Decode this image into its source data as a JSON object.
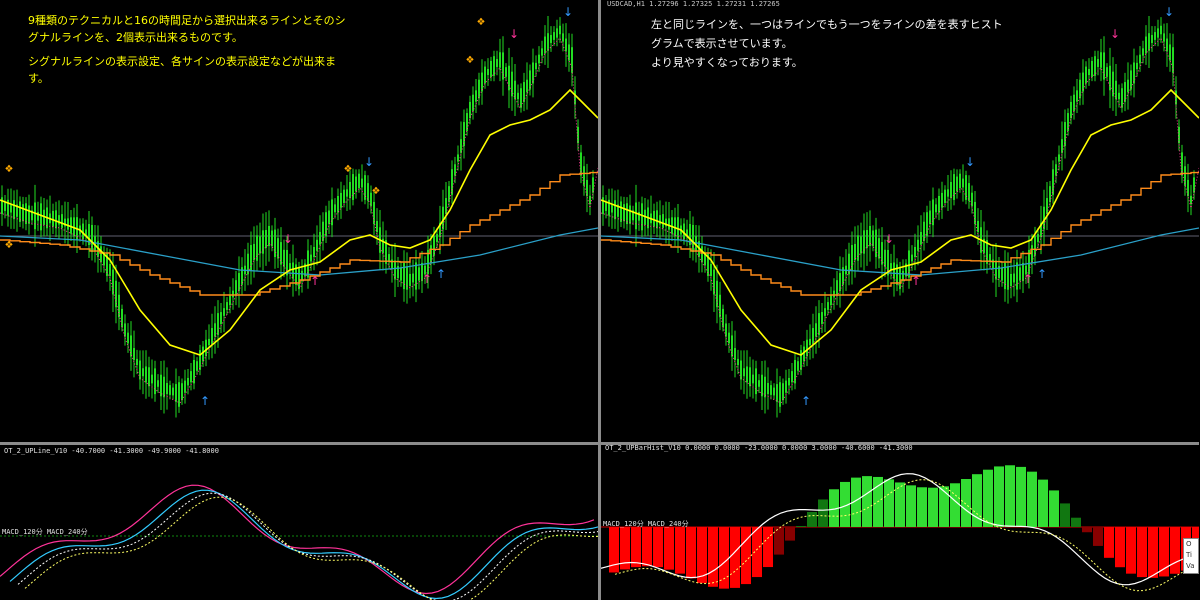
{
  "left": {
    "description_lines": [
      "9種類のテクニカルと16の時間足から選択出来るラインとそのシ",
      "グナルラインを、2個表示出来るものです。",
      "シグナルラインの表示設定、各サインの表示設定などが出来ま",
      "す。"
    ],
    "indicator_label": "OT_2_UPLine_V10 -40.7000 -41.3000 -49.9000 -41.8000",
    "macd_label": "MACD_120分  MACD_240分"
  },
  "right": {
    "symbol_label": "USDCAD,H1  1.27296 1.27325 1.27231 1.27265",
    "description_lines": [
      "左と同じラインを、一つはラインでもう一つをラインの差を表すヒスト",
      "グラムで表示させています。",
      "より見やすくなっております。"
    ],
    "indicator_label": "OT_2_UPBarHist_V10 0.0000 0.0000 -23.0000 0.0000 3.0000 -40.6000 -41.3000",
    "macd_label": "MACD_120分  MACD_240分",
    "popup_lines": [
      "O",
      "Ti",
      "Va"
    ]
  },
  "colors": {
    "background": "#000000",
    "candle": "#22dd22",
    "yellow_ma": "#ffff00",
    "orange_ma": "#ff8c1a",
    "blue_ma": "#2aa0c8",
    "signal_dots": "#ff3399",
    "up_arrow": "#3399ff",
    "down_arrow_blue": "#3399ff",
    "pink_arrow": "#ff3399",
    "diamond": "#ffaa00",
    "hist_up_bright": "#33dd33",
    "hist_up_dark": "#117711",
    "hist_down_bright": "#ff0000",
    "hist_down_dark": "#880000"
  }
}
